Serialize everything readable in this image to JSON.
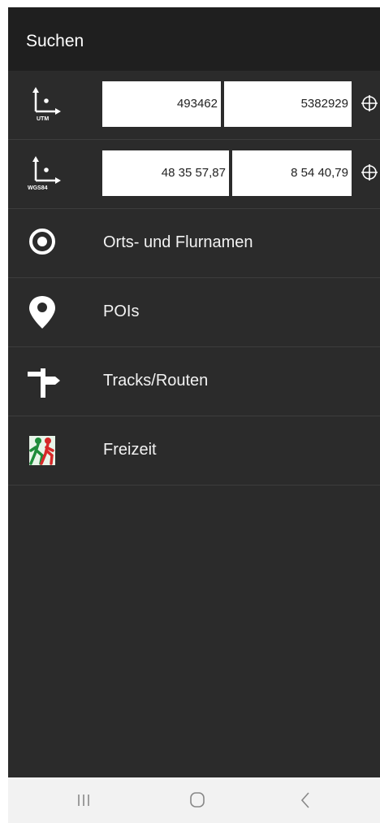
{
  "header": {
    "title": "Suchen"
  },
  "coordinates": {
    "utm": {
      "label": "UTM",
      "easting": "493462",
      "northing": "5382929",
      "icon": "utm-axis-icon"
    },
    "wgs84": {
      "label": "WGS84",
      "latitude": "48 35 57,87",
      "longitude": "8 54 40,79",
      "icon": "wgs84-axis-icon"
    }
  },
  "menu": [
    {
      "label": "Orts- und Flurnamen",
      "icon": "target-icon"
    },
    {
      "label": "POIs",
      "icon": "map-pin-icon"
    },
    {
      "label": "Tracks/Routen",
      "icon": "signpost-icon"
    },
    {
      "label": "Freizeit",
      "icon": "hikers-icon"
    }
  ],
  "colors": {
    "background": "#2b2b2b",
    "header": "#1f1f1f",
    "text": "#ffffff",
    "navbar": "#f2f2f2"
  },
  "navigation": [
    "recent-apps-icon",
    "home-icon",
    "back-icon"
  ]
}
